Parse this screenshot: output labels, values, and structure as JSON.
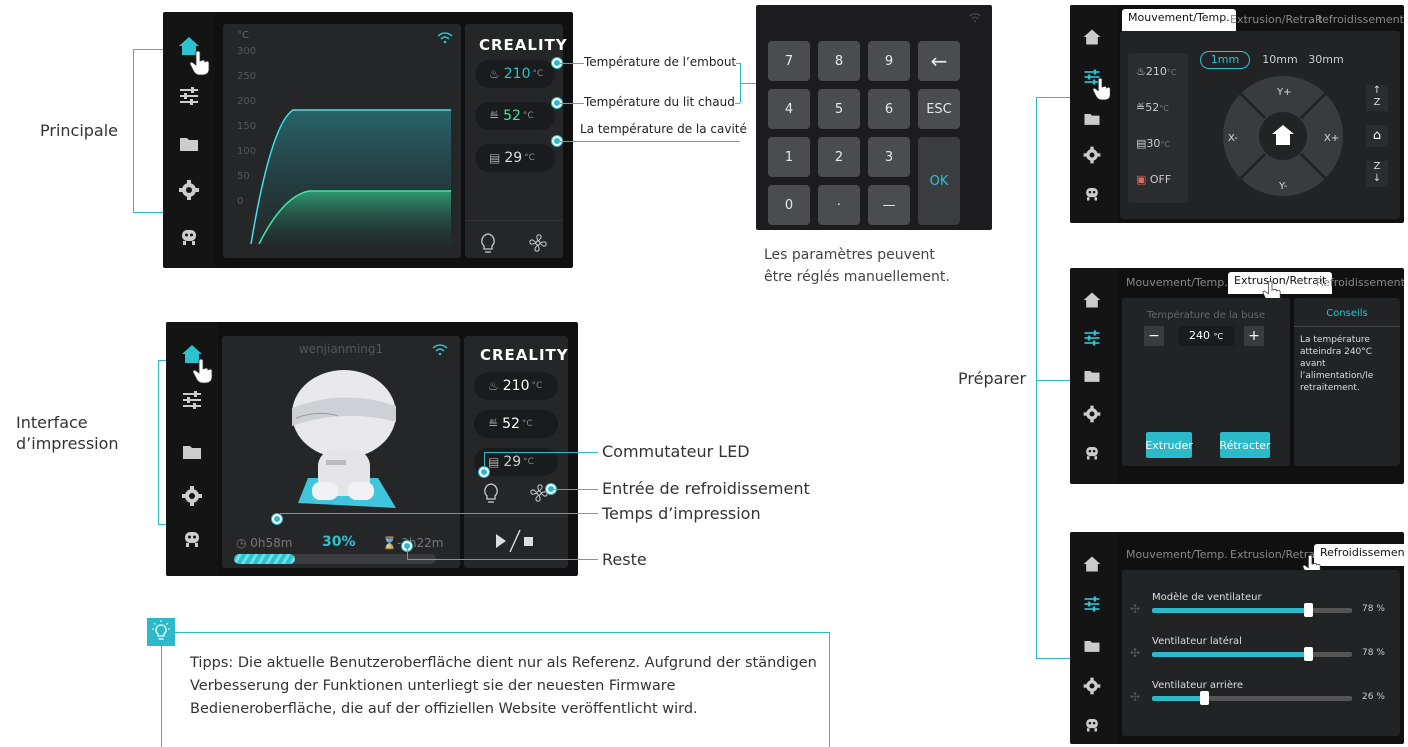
{
  "labels": {
    "principale": "Principale",
    "interface_line1": "Interface",
    "interface_line2": "d’impression",
    "preparer": "Préparer",
    "keypad_note_line1": "Les paramètres peuvent",
    "keypad_note_line2": "être réglés manuellement."
  },
  "main_screen": {
    "brand": "CREALITY",
    "unit": "°C",
    "y_ticks": [
      "300",
      "250",
      "200",
      "150",
      "100",
      "50",
      "0"
    ],
    "nozzle_temp": "210",
    "bed_temp": "52",
    "cavity_temp": "29",
    "temp_unit": "°C"
  },
  "callouts": {
    "nozzle": "Température de l’embout",
    "bed": "Température du lit chaud",
    "cavity": "La température de la cavité",
    "led": "Commutateur LED",
    "cooling": "Entrée de refroidissement",
    "print_time": "Temps d’impression",
    "remaining": "Reste"
  },
  "keypad": {
    "keys": [
      "7",
      "8",
      "9",
      "←",
      "4",
      "5",
      "6",
      "ESC",
      "1",
      "2",
      "3",
      "OK",
      "0",
      "·",
      "—"
    ]
  },
  "print_screen": {
    "user": "wenjianming1",
    "brand": "CREALITY",
    "nozzle_temp": "210",
    "bed_temp": "52",
    "cavity_temp": "29",
    "temp_unit": "°C",
    "elapsed": "0h58m",
    "percent": "30%",
    "remaining": "-3h22m",
    "progress_fraction": 0.3
  },
  "prep_move": {
    "tabs": [
      "Mouvement/Temp.",
      "Extrusion/Retrait",
      "Refroidissement"
    ],
    "nozzle": "210",
    "bed": "52",
    "cavity": "30",
    "temp_unit": "°C",
    "fan": "OFF",
    "steps": [
      "1mm",
      "10mm",
      "30mm"
    ],
    "dirs": {
      "yplus": "Y+",
      "yminus": "Y-",
      "xminus": "X-",
      "xplus": "X+"
    },
    "z_up": "Z",
    "z_down": "Z"
  },
  "prep_extrusion": {
    "tabs": [
      "Mouvement/Temp.",
      "Extrusion/Retrait",
      "Refroidissement"
    ],
    "temp_label": "Température de la buse",
    "temp_value": "240",
    "temp_unit": "°C",
    "minus": "−",
    "plus": "+",
    "extrude": "Extruder",
    "retract": "Rétracter",
    "tips_title": "Conseils",
    "tips_text": "La température atteindra 240°C avant l’alimentation/le retraitement."
  },
  "prep_cooling": {
    "tabs": [
      "Mouvement/Temp.",
      "Extrusion/Retrait",
      "Refroidissement"
    ],
    "fans": [
      {
        "name": "Modèle de ventilateur",
        "value": "78 %",
        "fraction": 0.78
      },
      {
        "name": "Ventilateur latéral",
        "value": "78 %",
        "fraction": 0.78
      },
      {
        "name": "Ventilateur arrière",
        "value": "26 %",
        "fraction": 0.26
      }
    ]
  },
  "tip": {
    "text": "Tipps: Die aktuelle Benutzeroberfläche dient nur als Referenz. Aufgrund der ständigen Verbesserung der Funktionen unterliegt sie der neuesten Firmware Bedieneroberfläche, die auf der offiziellen Website veröffentlicht wird."
  },
  "colors": {
    "accent": "#2cb9c9",
    "screen_bg": "#101010",
    "panel": "#252628"
  }
}
